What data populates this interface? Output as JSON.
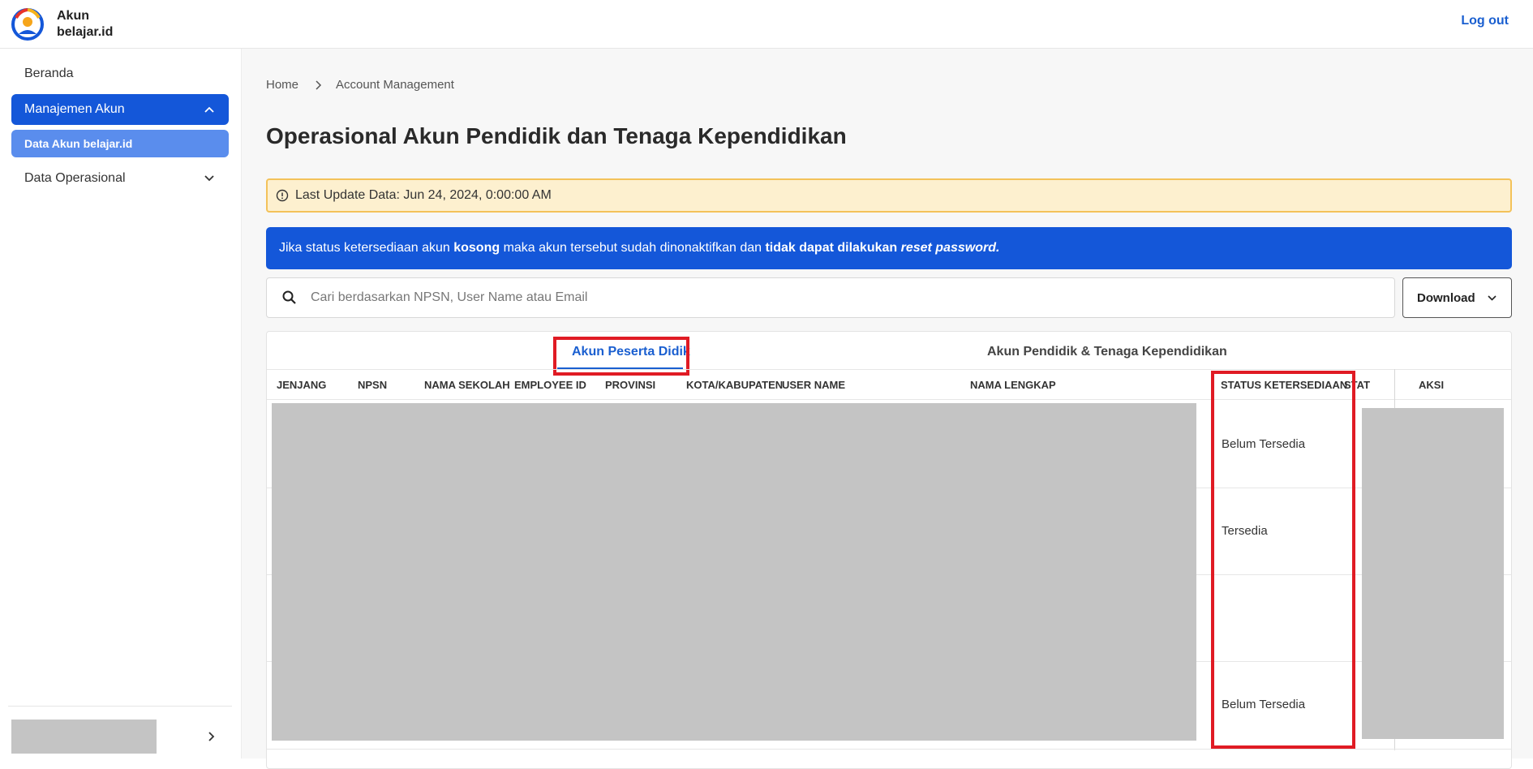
{
  "header": {
    "brand_line1": "Akun",
    "brand_line2": "belajar.id",
    "logout_label": "Log out",
    "logo_icon": "belajar-id-logo-icon"
  },
  "sidebar": {
    "items": [
      {
        "label": "Beranda"
      },
      {
        "label": "Manajemen Akun",
        "expanded": true
      },
      {
        "label": "Data Akun belajar.id",
        "active": true
      },
      {
        "label": "Data Operasional",
        "expanded": false
      }
    ]
  },
  "breadcrumb": {
    "home": "Home",
    "current": "Account Management"
  },
  "page": {
    "title": "Operasional Akun Pendidik dan Tenaga Kependidikan"
  },
  "alerts": {
    "last_update": "Last Update Data: Jun 24, 2024, 0:00:00 AM",
    "info_part1": "Jika status ketersediaan akun ",
    "info_bold1": "kosong",
    "info_part2": " maka akun tersebut sudah dinonaktifkan dan ",
    "info_bold2": "tidak dapat dilakukan ",
    "info_em": "reset password."
  },
  "search": {
    "placeholder": "Cari berdasarkan NPSN, User Name atau Email",
    "value": ""
  },
  "download": {
    "label": "Download"
  },
  "tabs": [
    {
      "label": "Akun Peserta Didik",
      "active": true
    },
    {
      "label": "Akun Pendidik & Tenaga Kependidikan",
      "active": false
    }
  ],
  "table": {
    "columns": [
      "JENJANG",
      "NPSN",
      "NAMA SEKOLAH",
      "EMPLOYEE ID",
      "PROVINSI",
      "KOTA/KABUPATEN",
      "USER NAME",
      "NAMA LENGKAP",
      "STATUS KETERSEDIAAN",
      "STATU",
      "AKSI"
    ],
    "rows": [
      {
        "status_ketersediaan": "Belum Tersedia"
      },
      {
        "status_ketersediaan": "Tersedia"
      },
      {
        "status_ketersediaan": ""
      },
      {
        "status_ketersediaan": "Belum Tersedia"
      }
    ]
  },
  "colors": {
    "primary": "#1457d9",
    "active_sub": "#5a8ded",
    "warning_bg": "#fdf0cf",
    "warning_border": "#f3c25a",
    "highlight_red": "#e01b24",
    "redacted_gray": "#c4c4c4"
  }
}
